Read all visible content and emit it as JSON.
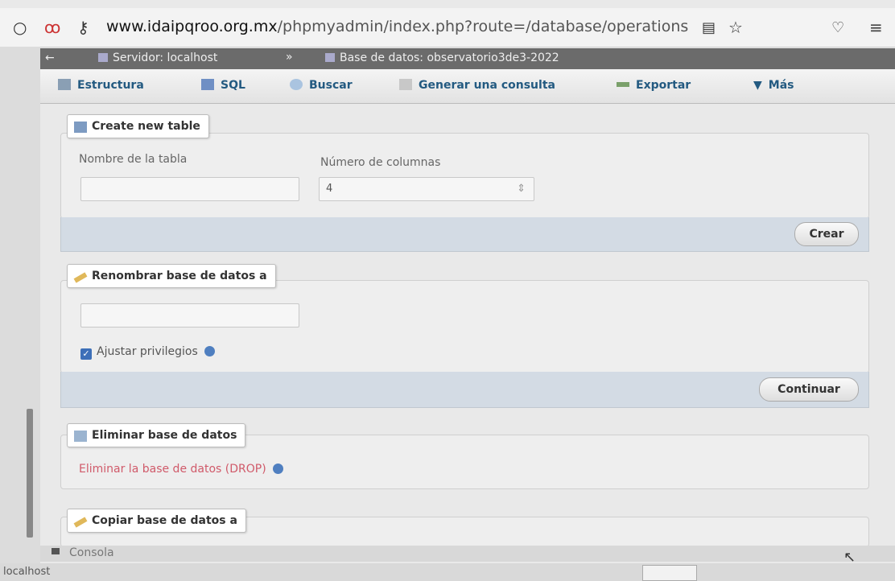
{
  "browser": {
    "url_host": "www.idaipqroo.org.mx",
    "url_path": "/phpmyadmin/index.php?route=/database/operations"
  },
  "breadcrumb": {
    "server": "Servidor: localhost",
    "separator": "»",
    "database": "Base de datos: observatorio3de3-2022"
  },
  "tabs": [
    {
      "label": "Estructura"
    },
    {
      "label": "SQL"
    },
    {
      "label": "Buscar"
    },
    {
      "label": "Generar una consulta"
    },
    {
      "label": "Exportar"
    },
    {
      "label": "Más"
    }
  ],
  "create_table": {
    "legend": "Create new table",
    "name_label": "Nombre de la tabla",
    "name_value": "",
    "columns_label": "Número de columnas",
    "columns_value": "4",
    "submit": "Crear"
  },
  "rename_db": {
    "legend": "Renombrar base de datos a",
    "value": "",
    "adjust_privileges": "Ajustar privilegios",
    "adjust_checked": true,
    "submit": "Continuar"
  },
  "drop_db": {
    "legend": "Eliminar base de datos",
    "link": "Eliminar la base de datos (DROP)"
  },
  "copy_db": {
    "legend": "Copiar base de datos a"
  },
  "console": {
    "label": "Consola"
  },
  "status": {
    "text": "localhost"
  },
  "colors": {
    "tab_link": "#235a81",
    "drop_link": "#d05a6a",
    "footer_bg": "#d3dbe4"
  }
}
